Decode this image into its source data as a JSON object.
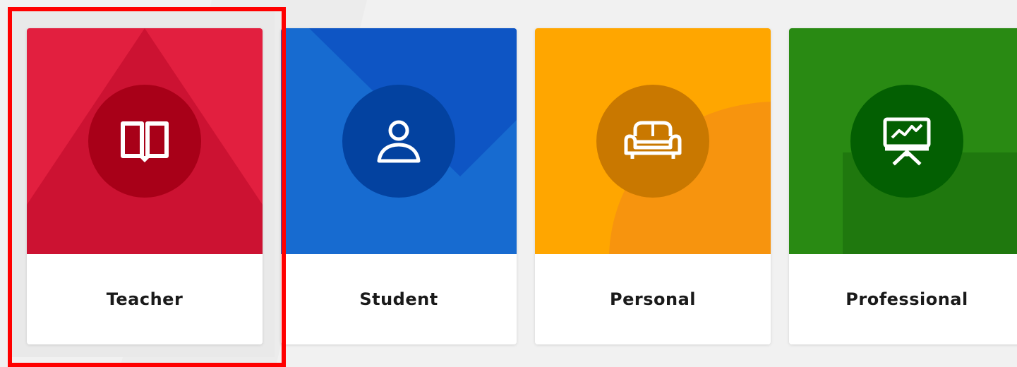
{
  "colors": {
    "background": "#f1f1f1",
    "selection_outline": "#ff0000",
    "teacher": "#e21f3f",
    "student": "#176bd0",
    "personal": "#ffa600",
    "professional": "#298a13"
  },
  "cards": [
    {
      "id": "teacher",
      "label": "Teacher",
      "icon": "open-book-icon",
      "selected": true
    },
    {
      "id": "student",
      "label": "Student",
      "icon": "person-icon",
      "selected": false
    },
    {
      "id": "personal",
      "label": "Personal",
      "icon": "sofa-icon",
      "selected": false
    },
    {
      "id": "professional",
      "label": "Professional",
      "icon": "presentation-board-icon",
      "selected": false
    }
  ]
}
